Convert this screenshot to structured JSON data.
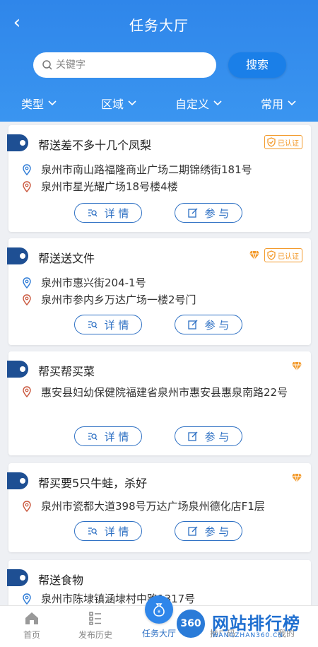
{
  "header": {
    "title": "任务大厅"
  },
  "search": {
    "placeholder": "关键字",
    "button": "搜索"
  },
  "filters": [
    "类型",
    "区域",
    "自定义",
    "常用"
  ],
  "colors": {
    "primary": "#2f86ea",
    "dark_tag": "#1e4f93",
    "accent_orange": "#f39a2b",
    "pin_blue": "#2c7ad6",
    "pin_red": "#c9563c"
  },
  "tasks": [
    {
      "title": "帮送差不多十几个凤梨",
      "diamond": false,
      "verified": true,
      "verified_label": "已认证",
      "from": "泉州市南山路福隆商业广场二期锦绣街181号",
      "to": "泉州市星光耀广场18号楼4楼"
    },
    {
      "title": "帮送送文件",
      "diamond": true,
      "verified": true,
      "verified_label": "已认证",
      "from": "泉州市惠兴街204-1号",
      "to": "泉州市参内乡万达广场一楼2号门"
    },
    {
      "title": "帮买帮买菜",
      "diamond": true,
      "verified": false,
      "to": "惠安县妇幼保健院福建省泉州市惠安县惠泉南路22号"
    },
    {
      "title": "帮买要5只牛蛙，杀好",
      "diamond": true,
      "verified": false,
      "to": "泉州市瓷都大道398号万达广场泉州德化店F1层"
    },
    {
      "title": "帮送食物",
      "diamond": false,
      "verified": false,
      "from": "泉州市陈埭镇涵埭村中路1317号"
    }
  ],
  "buttons": {
    "detail": "详 情",
    "join": "参 与"
  },
  "tabs": [
    "首页",
    "发布历史",
    "任务大厅",
    "推广码",
    "我的"
  ],
  "watermark": {
    "logo": "360",
    "title": "网站排行榜",
    "subtitle": "WANGZHAN360.CN"
  }
}
